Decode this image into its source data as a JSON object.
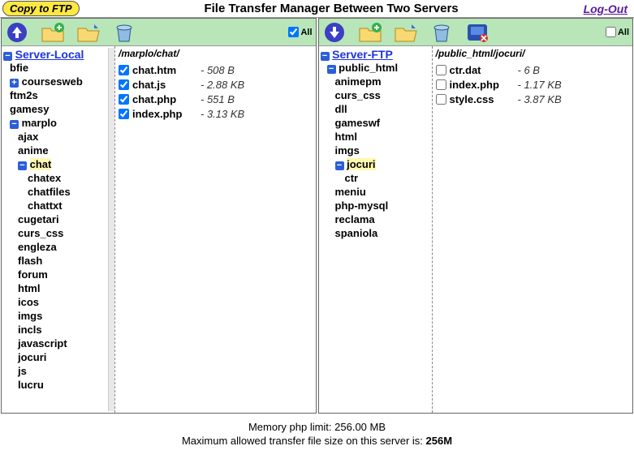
{
  "header": {
    "copy_label": "Copy to FTP",
    "title": "File Transfer Manager Between Two Servers",
    "logout": "Log-Out"
  },
  "left": {
    "server_label": "Server-Local",
    "all_label": "All",
    "path": "/marplo/chat/",
    "tree_top": [
      "bfie",
      "coursesweb",
      "ftm2s",
      "gamesy"
    ],
    "marplo": "marplo",
    "marplo_children_before": [
      "ajax",
      "anime"
    ],
    "chat": "chat",
    "chat_children": [
      "chatex",
      "chatfiles",
      "chattxt"
    ],
    "marplo_children_after": [
      "cugetari",
      "curs_css",
      "engleza",
      "flash",
      "forum",
      "html",
      "icos",
      "imgs",
      "incls",
      "javascript",
      "jocuri",
      "js",
      "lucru"
    ],
    "files": [
      {
        "name": "chat.htm",
        "size": "- 508 B",
        "checked": true
      },
      {
        "name": "chat.js",
        "size": "- 2.88 KB",
        "checked": true
      },
      {
        "name": "chat.php",
        "size": "- 551 B",
        "checked": true
      },
      {
        "name": "index.php",
        "size": "- 3.13 KB",
        "checked": true
      }
    ]
  },
  "right": {
    "server_label": "Server-FTP",
    "all_label": "All",
    "path": "/public_html/jocuri/",
    "public_html": "public_html",
    "children_before": [
      "animepm",
      "curs_css",
      "dll",
      "gameswf",
      "html",
      "imgs"
    ],
    "jocuri": "jocuri",
    "jocuri_children": [
      "ctr"
    ],
    "children_after": [
      "meniu",
      "php-mysql",
      "reclama",
      "spaniola"
    ],
    "files": [
      {
        "name": "ctr.dat",
        "size": "- 6 B",
        "checked": false
      },
      {
        "name": "index.php",
        "size": "- 1.17 KB",
        "checked": false
      },
      {
        "name": "style.css",
        "size": "- 3.87 KB",
        "checked": false
      }
    ]
  },
  "footer": {
    "line1": "Memory php limit: 256.00 MB",
    "line2a": "Maximum allowed transfer file size on this server is: ",
    "line2b": "256M"
  }
}
